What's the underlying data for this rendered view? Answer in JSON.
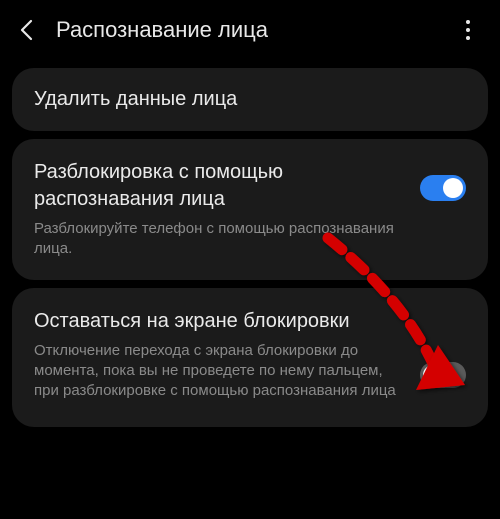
{
  "header": {
    "title": "Распознавание лица"
  },
  "delete_card": {
    "label": "Удалить данные лица"
  },
  "setting_unlock": {
    "title": "Разблокировка с помощью распознавания лица",
    "desc": "Разблокируйте телефон с помощью распознавания лица.",
    "state": "on"
  },
  "setting_stay": {
    "title": "Оставаться на экране блокировки",
    "desc": "Отключение перехода с экрана блокировки до момента, пока вы не проведете по нему пальцем, при разблокировке с помощью распознавания лица",
    "state": "off"
  },
  "colors": {
    "accent": "#2a7ff0",
    "arrow": "#d40000"
  }
}
